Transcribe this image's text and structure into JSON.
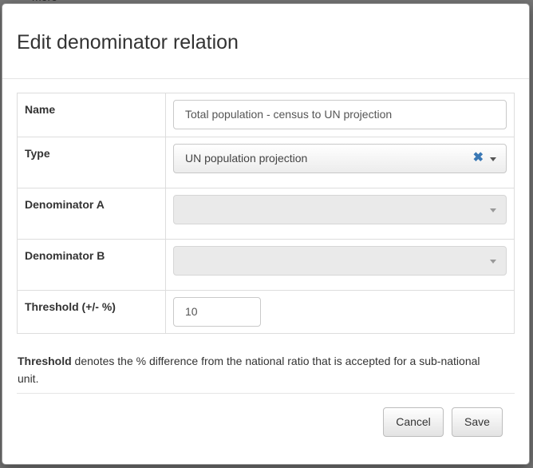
{
  "background": {
    "partial_text": "more"
  },
  "modal": {
    "title": "Edit denominator relation",
    "fields": {
      "name": {
        "label": "Name",
        "value": "Total population - census to UN projection"
      },
      "type": {
        "label": "Type",
        "value": "UN population projection",
        "clear_icon": "✖"
      },
      "denominator_a": {
        "label": "Denominator A",
        "value": ""
      },
      "denominator_b": {
        "label": "Denominator B",
        "value": ""
      },
      "threshold": {
        "label": "Threshold (+/- %)",
        "value": "10"
      }
    },
    "help": {
      "bold": "Threshold",
      "rest": " denotes the % difference from the national ratio that is accepted for a sub-national unit."
    },
    "buttons": {
      "cancel": "Cancel",
      "save": "Save"
    }
  },
  "colors": {
    "accent_clear": "#3a78b5",
    "overlay": "#767676"
  }
}
